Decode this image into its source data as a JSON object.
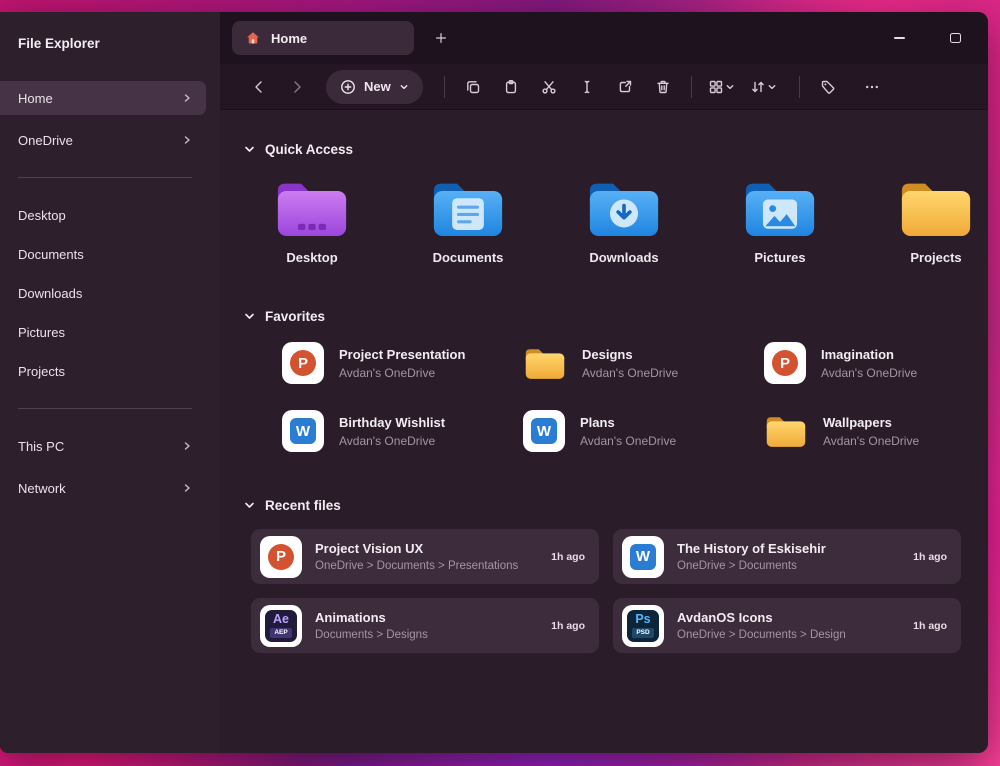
{
  "sidebar": {
    "title": "File Explorer",
    "top": [
      {
        "label": "Home"
      },
      {
        "label": "OneDrive"
      }
    ],
    "library": [
      {
        "label": "Desktop"
      },
      {
        "label": "Documents"
      },
      {
        "label": "Downloads"
      },
      {
        "label": "Pictures"
      },
      {
        "label": "Projects"
      }
    ],
    "bottom": [
      {
        "label": "This PC"
      },
      {
        "label": "Network"
      }
    ]
  },
  "tab": {
    "label": "Home"
  },
  "toolbar": {
    "new_label": "New"
  },
  "quick_access": {
    "title": "Quick Access",
    "items": [
      {
        "label": "Desktop"
      },
      {
        "label": "Documents"
      },
      {
        "label": "Downloads"
      },
      {
        "label": "Pictures"
      },
      {
        "label": "Projects"
      }
    ]
  },
  "favorites": {
    "title": "Favorites",
    "items": [
      {
        "name": "Project Presentation",
        "location": "Avdan's OneDrive"
      },
      {
        "name": "Designs",
        "location": "Avdan's OneDrive"
      },
      {
        "name": "Imagination",
        "location": "Avdan's OneDrive"
      },
      {
        "name": "Birthday Wishlist",
        "location": "Avdan's OneDrive"
      },
      {
        "name": "Plans",
        "location": "Avdan's OneDrive"
      },
      {
        "name": "Wallpapers",
        "location": "Avdan's OneDrive"
      }
    ]
  },
  "recent": {
    "title": "Recent files",
    "items": [
      {
        "name": "Project Vision UX",
        "path": "OneDrive > Documents > Presentations",
        "time": "1h ago"
      },
      {
        "name": "The History of Eskisehir",
        "path": "OneDrive > Documents",
        "time": "1h ago"
      },
      {
        "name": "Animations",
        "path": "Documents > Designs",
        "time": "1h ago"
      },
      {
        "name": "AvdanOS Icons",
        "path": "OneDrive > Documents > Design",
        "time": "1h ago"
      }
    ]
  },
  "file_glyphs": {
    "powerpoint": "P",
    "word": "W",
    "ae": "Ae",
    "ae_ext": "AEP",
    "ps": "Ps",
    "ps_ext": "PSD"
  },
  "colors": {
    "accent_pink": "#e91e8c",
    "window_bg": "#281a27",
    "folder_purple": "#b05ce8",
    "folder_blue": "#2f96ec",
    "folder_yellow": "#f6b93f",
    "powerpoint_orange": "#d35230",
    "word_blue": "#2b7cd3"
  }
}
